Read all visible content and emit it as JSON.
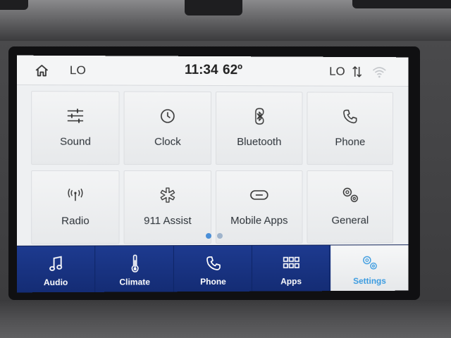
{
  "status_bar": {
    "left_label": "LO",
    "time": "11:34",
    "temperature": "62º",
    "right_label": "LO",
    "home_icon": "home-icon",
    "sort_icon": "sort-arrows-icon",
    "wifi_icon": "wifi-icon"
  },
  "tiles": [
    {
      "label": "Sound",
      "icon": "sliders-icon"
    },
    {
      "label": "Clock",
      "icon": "clock-icon"
    },
    {
      "label": "Bluetooth",
      "icon": "bluetooth-icon"
    },
    {
      "label": "Phone",
      "icon": "phone-icon"
    },
    {
      "label": "Radio",
      "icon": "radio-antenna-icon"
    },
    {
      "label": "911 Assist",
      "icon": "asterisk-icon"
    },
    {
      "label": "Mobile Apps",
      "icon": "link-icon"
    },
    {
      "label": "General",
      "icon": "gears-icon"
    }
  ],
  "pagination": {
    "pages": 2,
    "current": 1
  },
  "bottom_nav": [
    {
      "label": "Audio",
      "icon": "music-note-icon",
      "active": false
    },
    {
      "label": "Climate",
      "icon": "thermometer-icon",
      "active": false
    },
    {
      "label": "Phone",
      "icon": "phone-icon",
      "active": false
    },
    {
      "label": "Apps",
      "icon": "apps-grid-icon",
      "active": false
    },
    {
      "label": "Settings",
      "icon": "gears-icon",
      "active": true
    }
  ],
  "colors": {
    "nav_bg": "#1d3a8f",
    "active_text": "#3a9be0",
    "dot_active": "#4a8fd8",
    "dot_inactive": "#9fb4cc"
  }
}
